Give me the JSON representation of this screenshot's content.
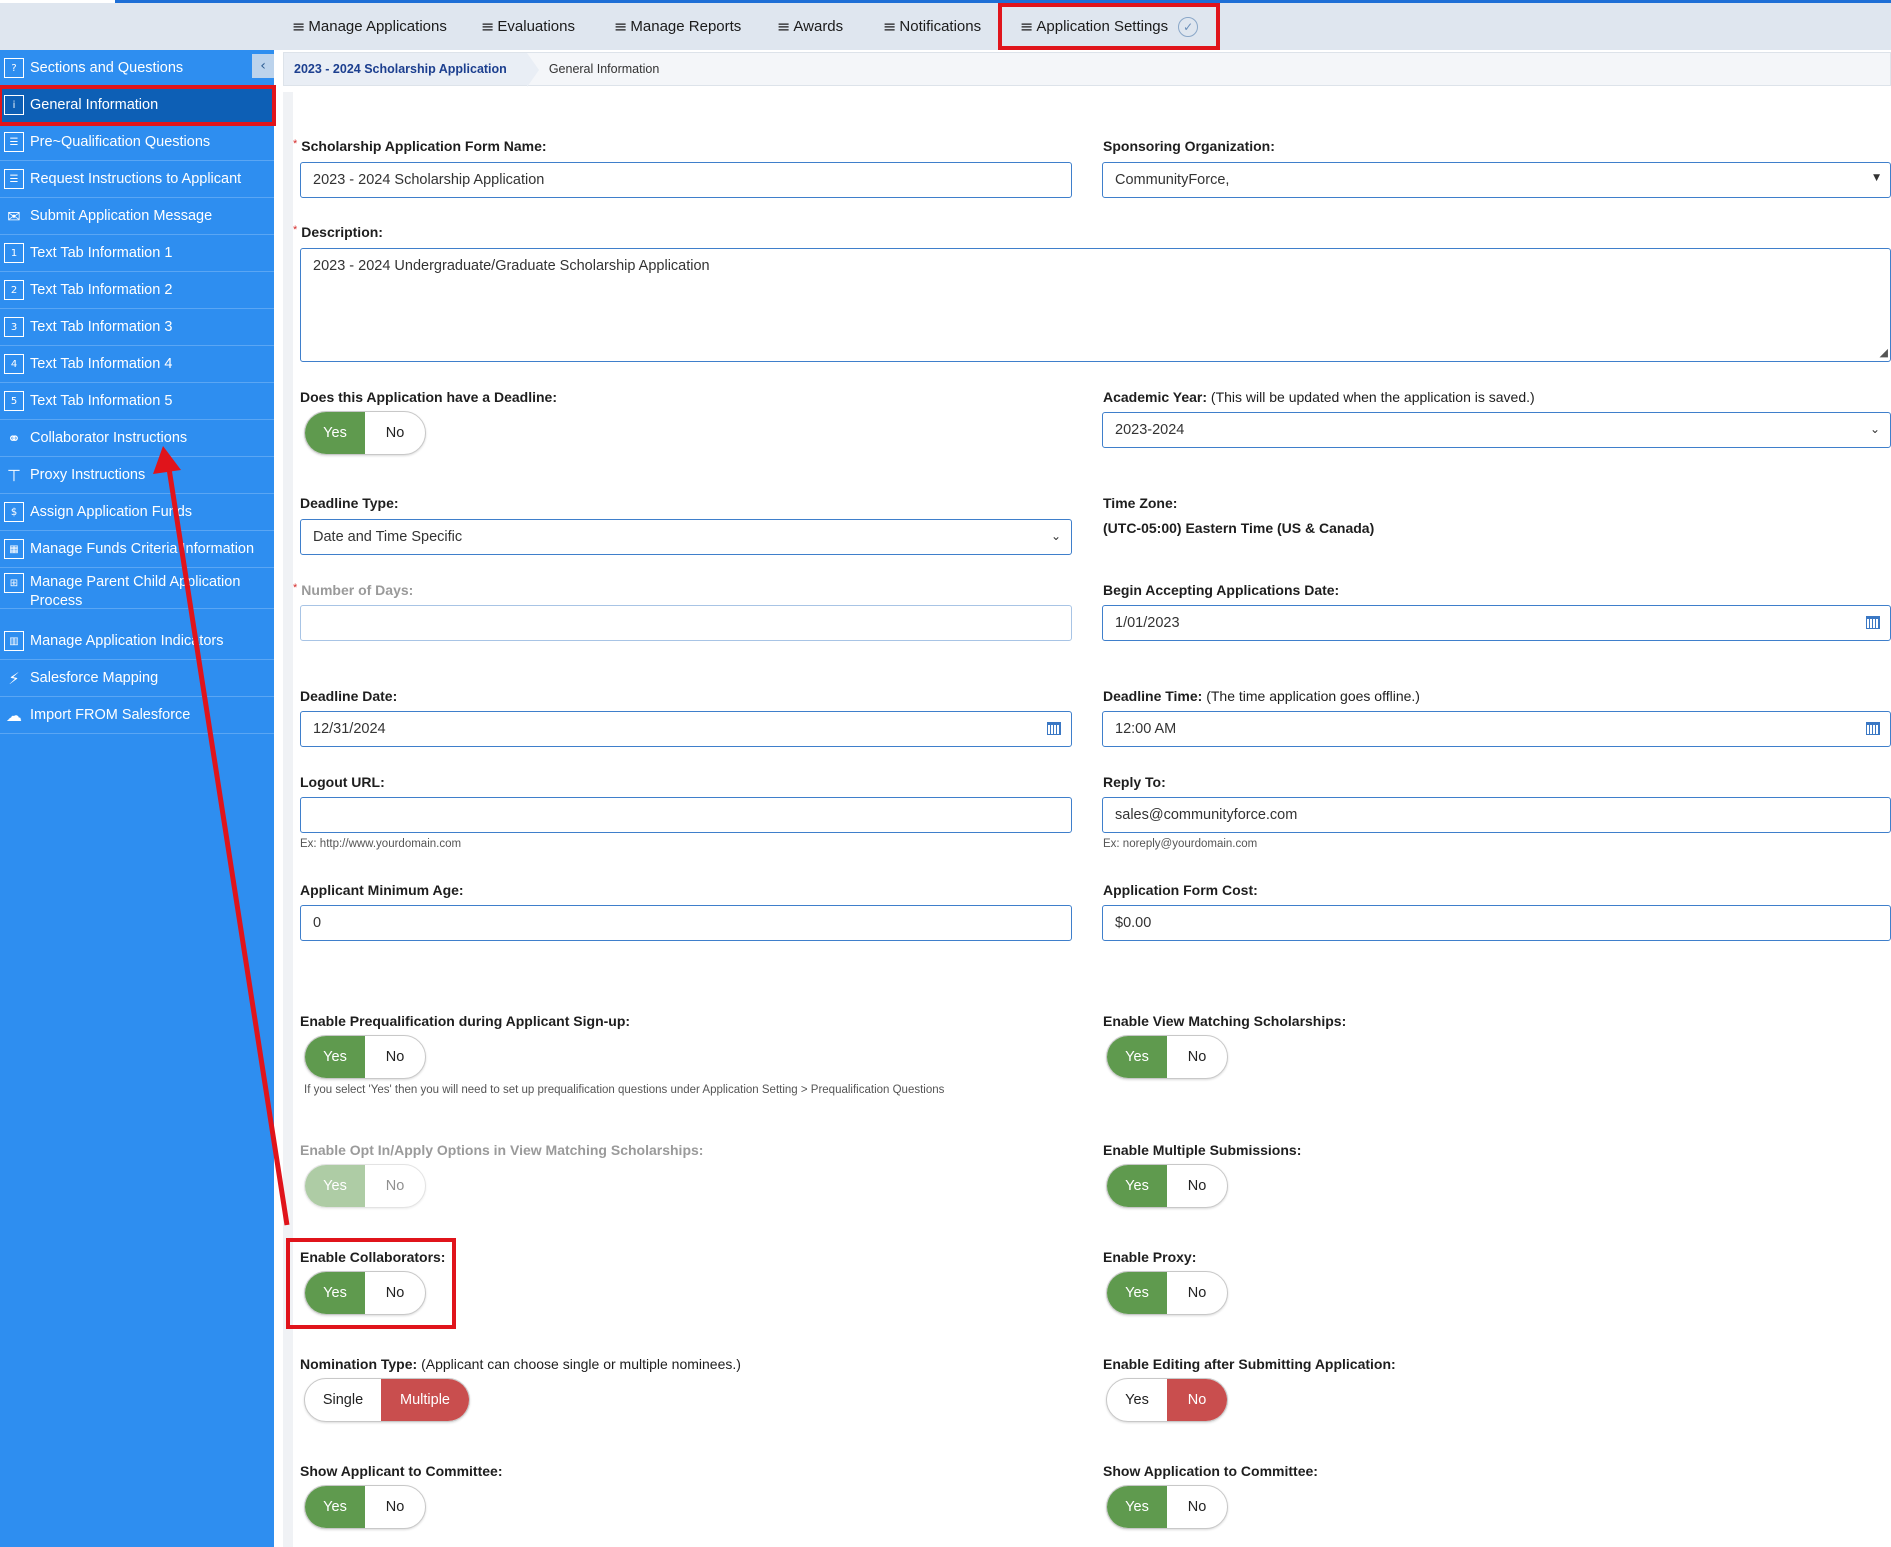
{
  "topnav": {
    "items": [
      {
        "label": "Manage Applications"
      },
      {
        "label": "Evaluations"
      },
      {
        "label": "Manage Reports"
      },
      {
        "label": "Awards"
      },
      {
        "label": "Notifications"
      },
      {
        "label": "Application Settings"
      }
    ]
  },
  "sidebar": {
    "items": [
      {
        "label": "Sections and Questions",
        "icon": "question-grid-icon"
      },
      {
        "label": "General Information",
        "icon": "info-icon"
      },
      {
        "label": "Pre~Qualification Questions",
        "icon": "checklist-icon"
      },
      {
        "label": "Request Instructions to Applicant",
        "icon": "list-icon"
      },
      {
        "label": "Submit Application Message",
        "icon": "envelope-icon"
      },
      {
        "label": "Text Tab Information 1",
        "icon": "tab-1-icon"
      },
      {
        "label": "Text Tab Information 2",
        "icon": "tab-2-icon"
      },
      {
        "label": "Text Tab Information 3",
        "icon": "tab-3-icon"
      },
      {
        "label": "Text Tab Information 4",
        "icon": "tab-4-icon"
      },
      {
        "label": "Text Tab Information 5",
        "icon": "tab-5-icon"
      },
      {
        "label": "Collaborator Instructions",
        "icon": "handshake-icon"
      },
      {
        "label": "Proxy Instructions",
        "icon": "hierarchy-icon"
      },
      {
        "label": "Assign Application Funds",
        "icon": "funds-icon"
      },
      {
        "label": "Manage Funds Criteria Information",
        "icon": "criteria-icon"
      },
      {
        "label": "Manage Parent Child Application Process",
        "icon": "parent-child-icon"
      },
      {
        "label": "Manage Application Indicators",
        "icon": "indicator-icon"
      },
      {
        "label": "Salesforce Mapping",
        "icon": "plug-icon"
      },
      {
        "label": "Import FROM Salesforce",
        "icon": "cloud-import-icon"
      }
    ],
    "active": "General Information"
  },
  "breadcrumb": {
    "parent": "2023 - 2024 Scholarship Application",
    "current": "General Information"
  },
  "form": {
    "form_name": {
      "label": "Scholarship Application Form Name:",
      "value": "2023 - 2024 Scholarship Application"
    },
    "sponsoring_org": {
      "label": "Sponsoring Organization:",
      "value": "CommunityForce,"
    },
    "description": {
      "label": "Description:",
      "value": "2023 - 2024 Undergraduate/Graduate Scholarship Application"
    },
    "has_deadline": {
      "label": "Does this Application have a Deadline:",
      "yes": "Yes",
      "no": "No",
      "selected": "Yes"
    },
    "academic_year": {
      "label": "Academic Year:",
      "note": "(This will be updated when the application is saved.)",
      "value": "2023-2024"
    },
    "deadline_type": {
      "label": "Deadline Type:",
      "value": "Date and Time Specific"
    },
    "time_zone": {
      "label": "Time Zone:",
      "value": "(UTC-05:00) Eastern Time (US & Canada)"
    },
    "number_of_days": {
      "label": "Number of Days:",
      "value": ""
    },
    "begin_date": {
      "label": "Begin Accepting Applications Date:",
      "value": "1/01/2023"
    },
    "deadline_date": {
      "label": "Deadline Date:",
      "value": "12/31/2024"
    },
    "deadline_time": {
      "label": "Deadline Time:",
      "note": "(The time application goes offline.)",
      "value": "12:00 AM"
    },
    "logout_url": {
      "label": "Logout URL:",
      "value": "",
      "hint": "Ex: http://www.yourdomain.com"
    },
    "reply_to": {
      "label": "Reply To:",
      "value": "sales@communityforce.com",
      "hint": "Ex: noreply@yourdomain.com"
    },
    "min_age": {
      "label": "Applicant Minimum Age:",
      "value": "0"
    },
    "form_cost": {
      "label": "Application Form Cost:",
      "value": "$0.00"
    },
    "prequal": {
      "label": "Enable Prequalification during Applicant Sign-up:",
      "yes": "Yes",
      "no": "No",
      "selected": "Yes",
      "hint": "If you select 'Yes' then you will need to set up prequalification questions under Application Setting > Prequalification Questions"
    },
    "view_matching": {
      "label": "Enable View Matching Scholarships:",
      "yes": "Yes",
      "no": "No",
      "selected": "Yes"
    },
    "opt_in": {
      "label": "Enable Opt In/Apply Options in View Matching Scholarships:",
      "yes": "Yes",
      "no": "No",
      "selected": "Yes",
      "disabled": true
    },
    "multiple_submissions": {
      "label": "Enable Multiple Submissions:",
      "yes": "Yes",
      "no": "No",
      "selected": "Yes"
    },
    "collaborators": {
      "label": "Enable Collaborators:",
      "yes": "Yes",
      "no": "No",
      "selected": "Yes"
    },
    "proxy": {
      "label": "Enable Proxy:",
      "yes": "Yes",
      "no": "No",
      "selected": "Yes"
    },
    "nomination_type": {
      "label": "Nomination Type:",
      "note": "(Applicant can choose single or multiple nominees.)",
      "single": "Single",
      "multiple": "Multiple",
      "selected": "Multiple"
    },
    "editing_after_submit": {
      "label": "Enable Editing after Submitting Application:",
      "yes": "Yes",
      "no": "No",
      "selected": "No"
    },
    "show_applicant": {
      "label": "Show Applicant to Committee:",
      "yes": "Yes",
      "no": "No",
      "selected": "Yes"
    },
    "show_application": {
      "label": "Show Application to Committee:",
      "yes": "Yes",
      "no": "No",
      "selected": "Yes"
    }
  },
  "colors": {
    "sidebar": "#2e8ef0",
    "active_item": "#0d5fb5",
    "toggle_green": "#5f9a4e",
    "toggle_red": "#c94e4e",
    "annotation_red": "#e0141b"
  }
}
